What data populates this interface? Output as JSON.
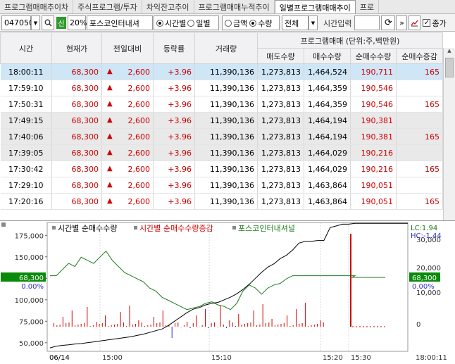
{
  "tabs": [
    "프로그램매매추이차",
    "주식프로그램/투자",
    "차익잔고추이",
    "프로그램매매누적추이",
    "일별프로그램매매추이",
    "프로"
  ],
  "toolbar": {
    "code": "047050",
    "badge": "신",
    "rate": "20%",
    "name": "포스코인터내셔",
    "radio_time": "시간별",
    "radio_day": "일별",
    "radio_amount": "금액",
    "radio_qty": "수량",
    "market": "전체",
    "time_input_label": "시간입력",
    "check_label": "종가"
  },
  "table": {
    "headers": [
      "시간",
      "현재가",
      "전일대비",
      "등락률",
      "거래량"
    ],
    "group_header": "프로그램매매 (단위:주,백만원)",
    "sub_headers": [
      "매도수량",
      "매수수량",
      "순매수수량",
      "순매수증감"
    ],
    "rows": [
      [
        "18:00:11",
        "68,300",
        "▲",
        "2,600",
        "+3.96",
        "11,390,136",
        "1,273,813",
        "1,464,524",
        "190,711",
        "165"
      ],
      [
        "17:59:10",
        "68,300",
        "▲",
        "2,600",
        "+3.96",
        "11,390,136",
        "1,273,813",
        "1,464,359",
        "190,546",
        ""
      ],
      [
        "17:50:31",
        "68,300",
        "▲",
        "2,600",
        "+3.96",
        "11,390,136",
        "1,273,813",
        "1,464,359",
        "190,546",
        "165"
      ],
      [
        "17:49:15",
        "68,300",
        "▲",
        "2,600",
        "+3.96",
        "11,390,136",
        "1,273,813",
        "1,464,194",
        "190,381",
        ""
      ],
      [
        "17:40:06",
        "68,300",
        "▲",
        "2,600",
        "+3.96",
        "11,390,136",
        "1,273,813",
        "1,464,194",
        "190,381",
        "165"
      ],
      [
        "17:39:05",
        "68,300",
        "▲",
        "2,600",
        "+3.96",
        "11,390,136",
        "1,273,813",
        "1,464,029",
        "190,216",
        ""
      ],
      [
        "17:30:42",
        "68,300",
        "▲",
        "2,600",
        "+3.96",
        "11,390,136",
        "1,273,813",
        "1,464,029",
        "190,216",
        "165"
      ],
      [
        "17:29:10",
        "68,300",
        "▲",
        "2,600",
        "+3.96",
        "11,390,136",
        "1,273,813",
        "1,463,864",
        "190,051",
        ""
      ],
      [
        "17:20:16",
        "68,300",
        "▲",
        "2,600",
        "+3.96",
        "11,390,136",
        "1,273,813",
        "1,463,864",
        "190,051",
        "165"
      ]
    ]
  },
  "chart_data": {
    "type": "line",
    "legend": [
      "시간별 순매수수량",
      "시간별 순매수수량증감",
      "포스코인터내셔널"
    ],
    "left_axis": [
      "175,000",
      "150,000",
      "125,000",
      "100,000",
      "75,000",
      "50,000"
    ],
    "price_label": "68,300",
    "price_pct": "0.00%",
    "right_axis": [
      "30,000",
      "20,000",
      "10,000",
      "0"
    ],
    "right_price": "68,300",
    "right_pct": "0.00%",
    "lc": "LC:1.94",
    "hc": "HC:-1.44",
    "x_labels": [
      "06/14",
      "15:00",
      "15:10",
      "15:20",
      "15:30",
      "18:00:11"
    ],
    "net_buy": [
      44000,
      46000,
      47000,
      47500,
      48500,
      49000,
      50000,
      51000,
      52000,
      53000,
      54000,
      55000,
      56000,
      57000,
      58500,
      60000,
      62000,
      64000,
      66000,
      70000,
      75000,
      80000,
      85000,
      89000,
      91000,
      94000,
      96000,
      97000,
      100000,
      103000,
      107000,
      112000,
      118000,
      125000,
      132000,
      138000,
      142000,
      148000,
      152000,
      158000,
      166000,
      168000,
      168000,
      169000,
      169000,
      184000,
      186000,
      188000,
      188000,
      189000
    ],
    "price": [
      68300,
      68300,
      68320,
      68340,
      68330,
      68360,
      68350,
      68340,
      68360,
      68380,
      68350,
      68330,
      68310,
      68300,
      68290,
      68280,
      68260,
      68250,
      68230,
      68220,
      68210,
      68200,
      68190,
      68195,
      68200,
      68210,
      68215,
      68205,
      68200,
      68190,
      68210,
      68250,
      68270,
      68260,
      68240,
      68260,
      68270,
      68275,
      68290,
      68300,
      68300,
      68300,
      68300,
      68300,
      68300,
      68300,
      68300,
      68300,
      68300,
      68300
    ],
    "color_net": "#000000",
    "color_price": "#1a7a1a",
    "color_delta": "#d00000"
  }
}
